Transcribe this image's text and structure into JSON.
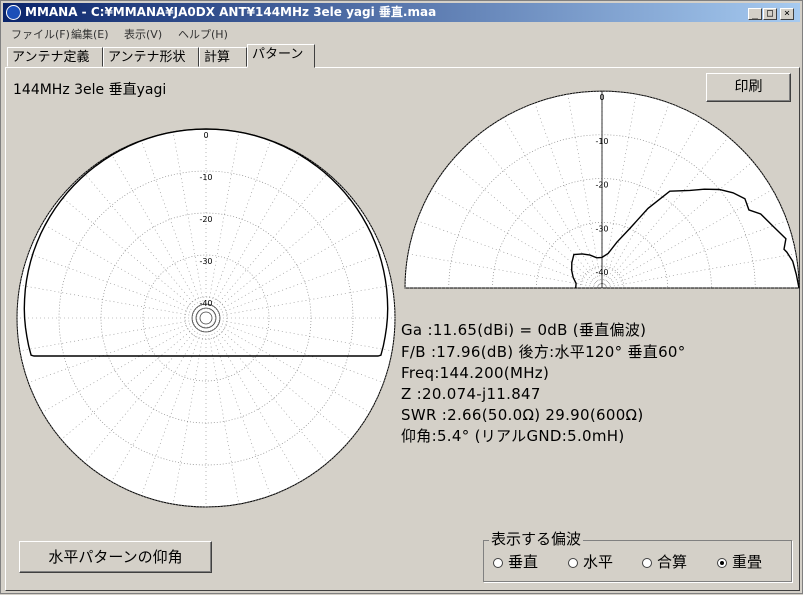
{
  "window": {
    "title": "MMANA - C:¥MMANA¥JA0DX ANT¥144MHz 3ele yagi 垂直.maa",
    "controls": [
      "_",
      "□",
      "×"
    ]
  },
  "menu": [
    "ファイル(F)",
    "編集(E)",
    "表示(V)",
    "ヘルプ(H)"
  ],
  "tabs": [
    {
      "label": "アンテナ定義",
      "active": false
    },
    {
      "label": "アンテナ形状",
      "active": false
    },
    {
      "label": "計算",
      "active": false
    },
    {
      "label": "パターン",
      "active": true
    }
  ],
  "heading": "144MHz 3ele 垂直yagi",
  "print_button": "印刷",
  "charts": {
    "horizontal_ticks": [
      "0",
      "-10",
      "-20",
      "-30",
      "-40"
    ],
    "vertical_ticks": [
      "0",
      "-10",
      "-20",
      "-30",
      "-40"
    ],
    "vertical_pattern_elevation": [
      [
        0,
        0
      ],
      [
        4,
        -0.5
      ],
      [
        8,
        -1
      ],
      [
        11,
        -2
      ],
      [
        12,
        -2.5
      ],
      [
        15,
        -1.5
      ],
      [
        20,
        -3.5
      ],
      [
        25,
        -5
      ],
      [
        28,
        -7
      ],
      [
        32,
        -6.5
      ],
      [
        36,
        -8
      ],
      [
        40,
        -10
      ],
      [
        44,
        -12.5
      ],
      [
        48,
        -15
      ],
      [
        55,
        -18
      ],
      [
        60,
        -24
      ],
      [
        65,
        -30
      ],
      [
        72,
        -34
      ],
      [
        80,
        -37
      ],
      [
        90,
        -38
      ],
      [
        100,
        -38
      ],
      [
        110,
        -37
      ],
      [
        120,
        -36
      ],
      [
        130,
        -35
      ],
      [
        140,
        -36
      ],
      [
        150,
        -37
      ],
      [
        160,
        -38
      ],
      [
        170,
        -39
      ],
      [
        180,
        -39
      ]
    ]
  },
  "info": {
    "gain": "Ga  :11.65(dBi) = 0dB  (垂直偏波)",
    "fb": "F/B :17.96(dB) 後方:水平120°  垂直60°",
    "freq": "Freq:144.200(MHz)",
    "z": "Z   :20.074-j11.847",
    "swr": "SWR :2.66(50.0Ω) 29.90(600Ω)",
    "elev": "仰角:5.4° (リアルGND:5.0mH)"
  },
  "elevation_button": "水平パターンの仰角",
  "polarization": {
    "legend": "表示する偏波",
    "options": [
      "垂直",
      "水平",
      "合算",
      "重畳"
    ],
    "selected": "重畳"
  }
}
